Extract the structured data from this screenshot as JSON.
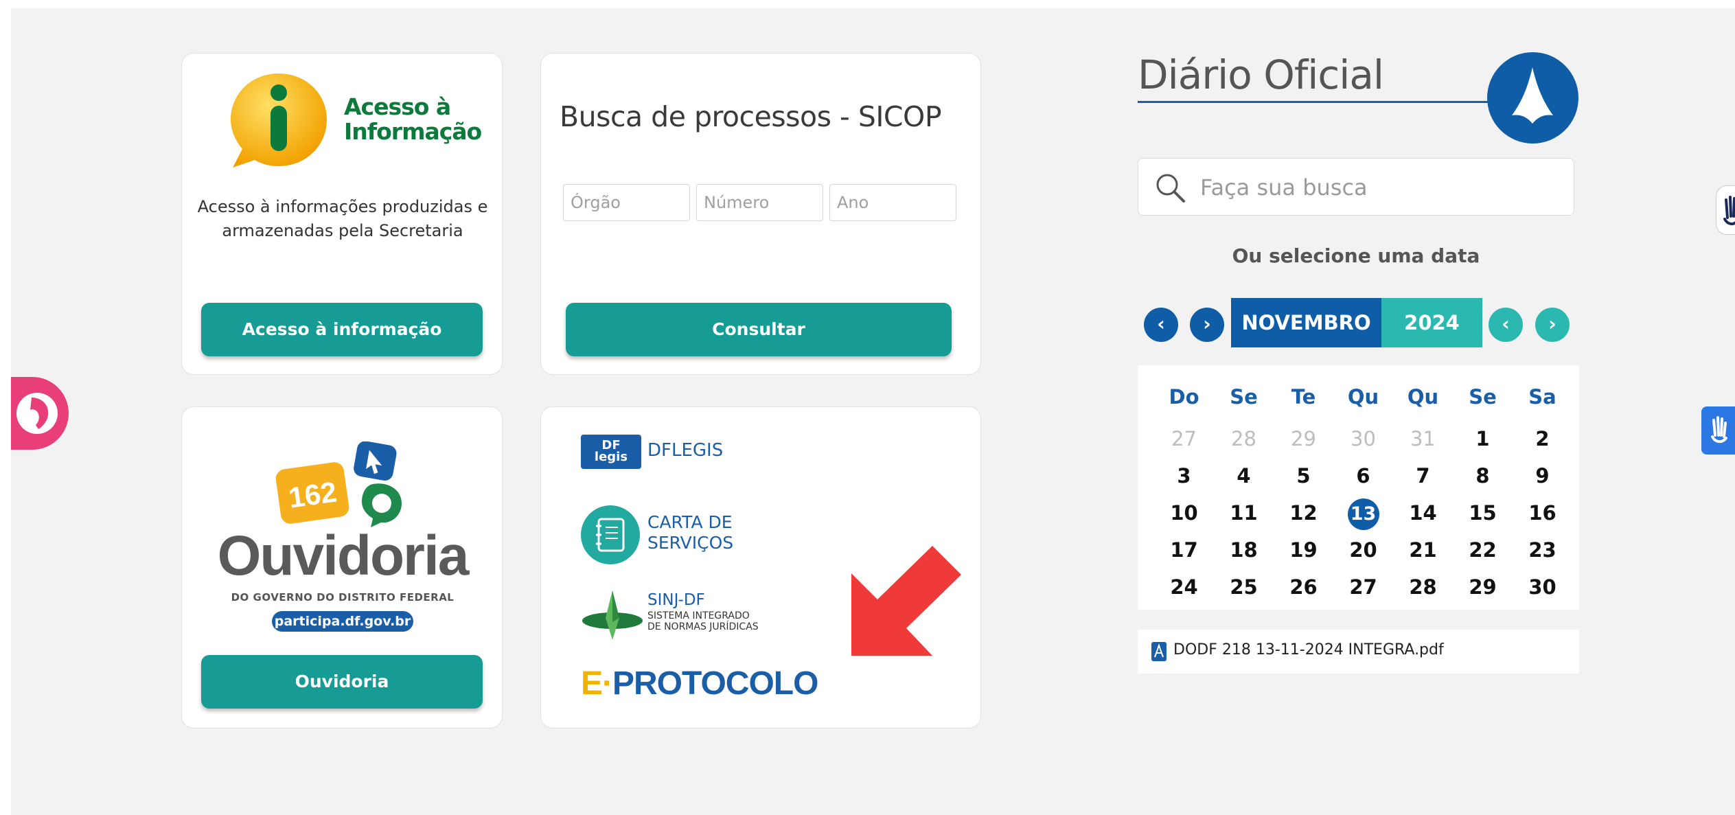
{
  "access_card": {
    "logo_text_line1": "Acesso à",
    "logo_text_line2": "Informação",
    "description_line1": "Acesso à informações produzidas e",
    "description_line2": "armazenadas pela Secretaria",
    "button_label": "Acesso à informação"
  },
  "sicop_card": {
    "title": "Busca de processos - SICOP",
    "orgao_placeholder": "Órgão",
    "numero_placeholder": "Número",
    "ano_placeholder": "Ano",
    "button_label": "Consultar"
  },
  "ouvidoria_card": {
    "badge_number": "162",
    "wordmark": "Ouvidoria",
    "subtitle": "DO GOVERNO DO DISTRITO FEDERAL",
    "site_pill": "participa.df.gov.br",
    "button_label": "Ouvidoria"
  },
  "links_card": {
    "dflegis_badge_line1": "DF",
    "dflegis_badge_line2": "legis",
    "dflegis_label": "DFLEGIS",
    "carta_line1": "CARTA DE",
    "carta_line2": "SERVIÇOS",
    "sinj_title": "SINJ-DF",
    "sinj_sub_line1": "SISTEMA INTEGRADO",
    "sinj_sub_line2": "DE NORMAS JURÍDICAS",
    "eprotocolo_e": "E·",
    "eprotocolo_label": "PROTOCOLO"
  },
  "diario": {
    "title": "Diário Oficial",
    "search_placeholder": "Faça sua busca",
    "select_date_label": "Ou selecione uma data",
    "month": "NOVEMBRO",
    "year": "2024",
    "prev_month_glyph": "‹",
    "next_month_glyph": "›",
    "prev_year_glyph": "‹",
    "next_year_glyph": "›",
    "weekdays": [
      "Do",
      "Se",
      "Te",
      "Qu",
      "Qu",
      "Se",
      "Sa"
    ],
    "days": [
      {
        "d": "27",
        "muted": true
      },
      {
        "d": "28",
        "muted": true
      },
      {
        "d": "29",
        "muted": true
      },
      {
        "d": "30",
        "muted": true
      },
      {
        "d": "31",
        "muted": true
      },
      {
        "d": "1"
      },
      {
        "d": "2"
      },
      {
        "d": "3"
      },
      {
        "d": "4"
      },
      {
        "d": "5"
      },
      {
        "d": "6"
      },
      {
        "d": "7"
      },
      {
        "d": "8"
      },
      {
        "d": "9"
      },
      {
        "d": "10"
      },
      {
        "d": "11"
      },
      {
        "d": "12"
      },
      {
        "d": "13",
        "today": true
      },
      {
        "d": "14"
      },
      {
        "d": "15"
      },
      {
        "d": "16"
      },
      {
        "d": "17"
      },
      {
        "d": "18"
      },
      {
        "d": "19"
      },
      {
        "d": "20"
      },
      {
        "d": "21"
      },
      {
        "d": "22"
      },
      {
        "d": "23"
      },
      {
        "d": "24"
      },
      {
        "d": "25"
      },
      {
        "d": "26"
      },
      {
        "d": "27"
      },
      {
        "d": "28"
      },
      {
        "d": "29"
      },
      {
        "d": "30"
      }
    ],
    "pdf_file": "DODF 218 13-11-2024 INTEGRA.pdf"
  },
  "colors": {
    "teal": "#169c94",
    "blue": "#0e5da6",
    "light_teal": "#2ab8b0",
    "pink": "#e83e79",
    "red_arrow": "#f03a3a"
  },
  "icons": {
    "left_widget": "accessibility-face-icon",
    "right_top_widget": "sign-language-hand-icon",
    "right_blue_widget": "vlibras-hands-icon",
    "search": "search-icon",
    "pdf": "pdf-icon",
    "arrow": "red-arrow-icon"
  }
}
